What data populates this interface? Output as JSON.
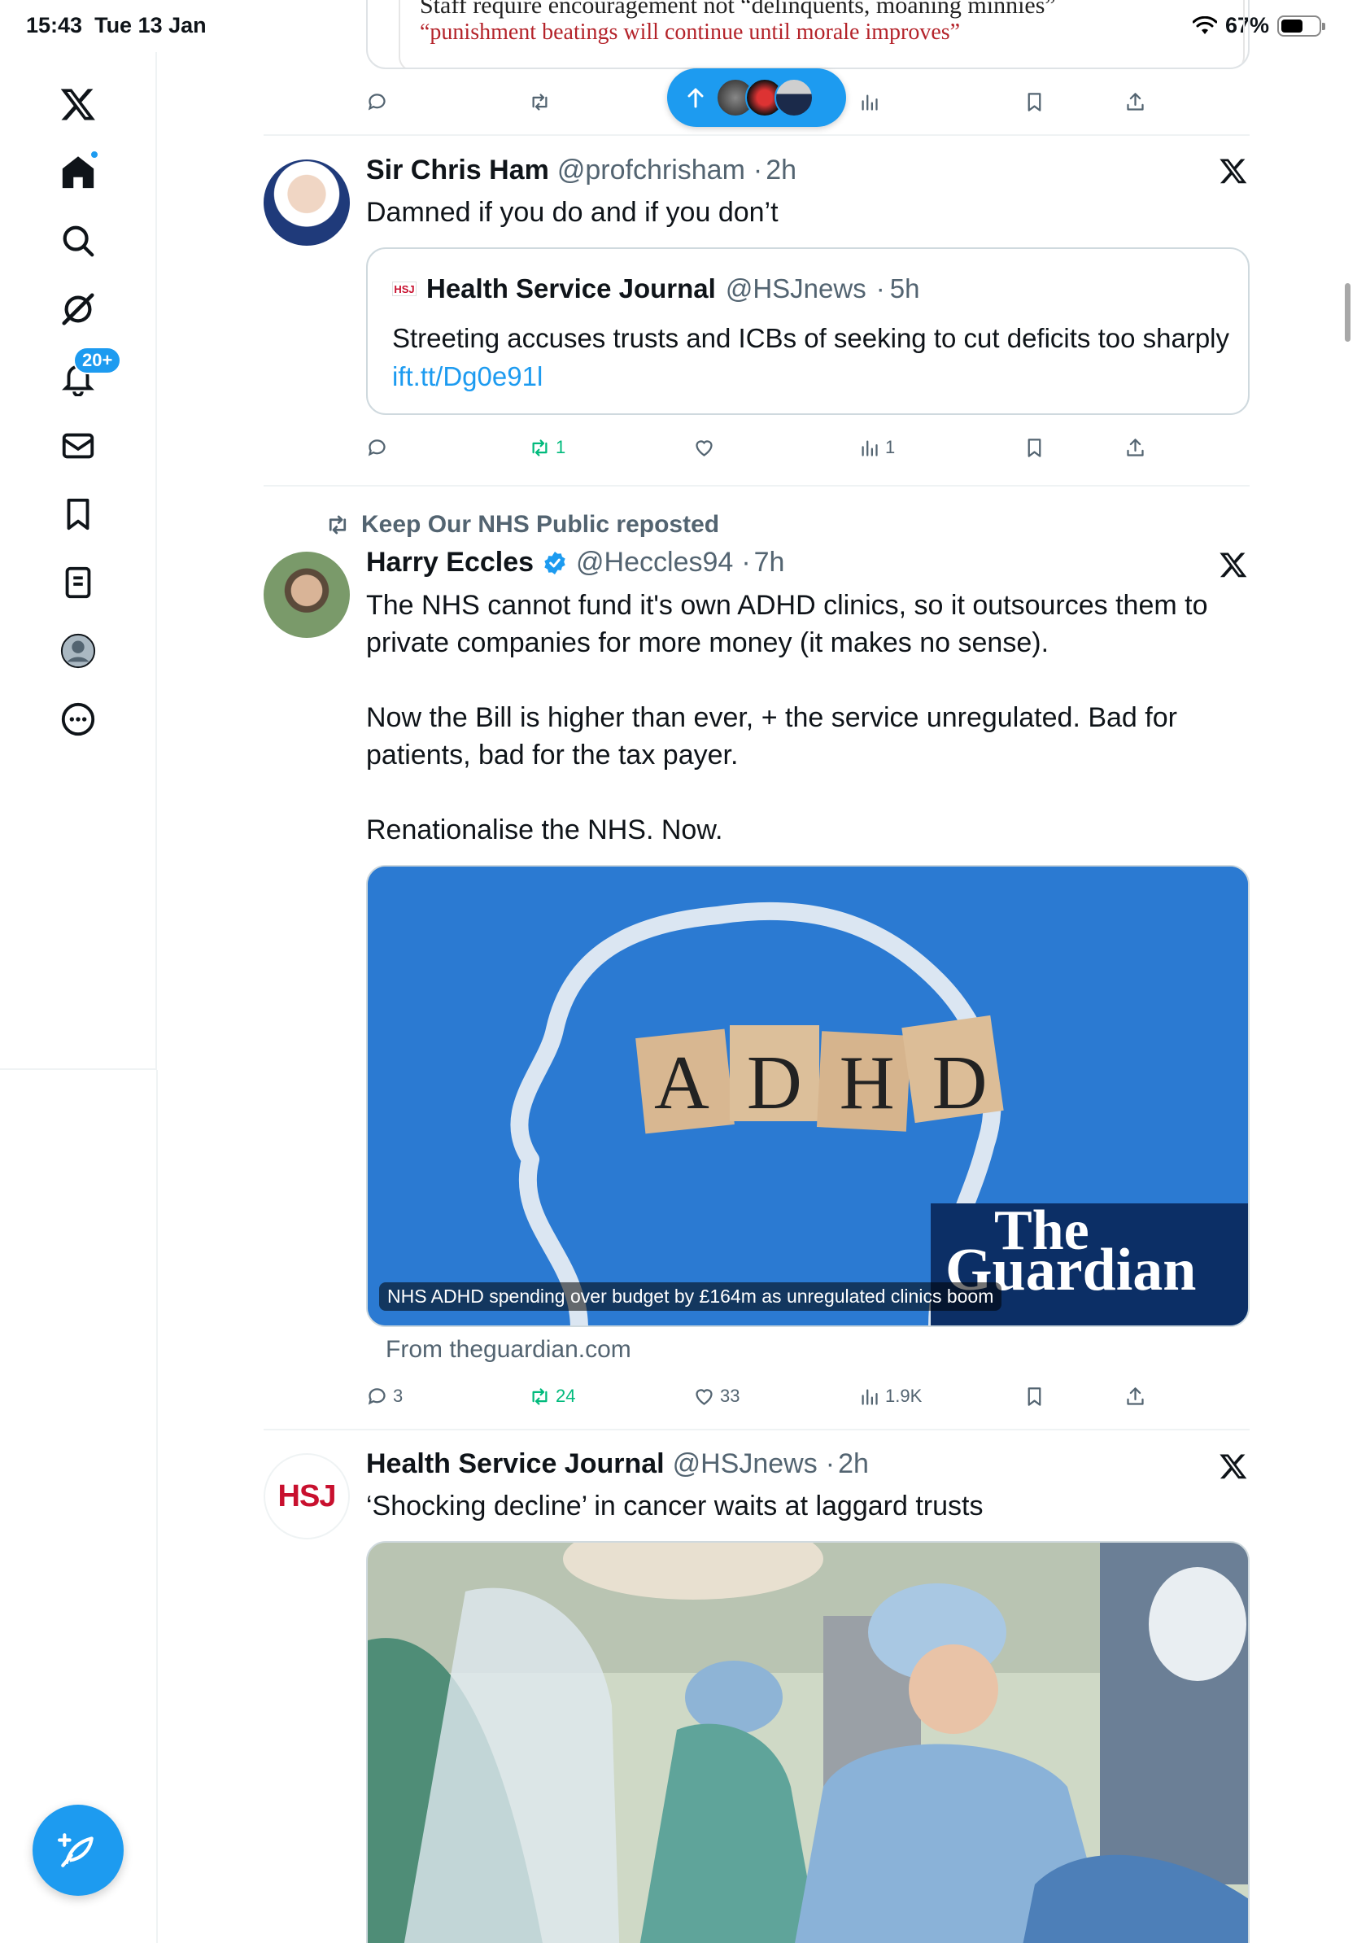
{
  "status_bar": {
    "time": "15:43",
    "date": "Tue 13 Jan",
    "battery": "67%"
  },
  "sidebar": {
    "items": [
      {
        "name": "home"
      },
      {
        "name": "search"
      },
      {
        "name": "grok"
      },
      {
        "name": "notifications",
        "badge": "20+"
      },
      {
        "name": "messages"
      },
      {
        "name": "bookmarks"
      },
      {
        "name": "lists"
      },
      {
        "name": "profile"
      },
      {
        "name": "more"
      }
    ]
  },
  "previous_post": {
    "quote_line1": "Staff require encouragement not “delinquents, moaning minnies”",
    "quote_line2": "“punishment beatings will continue until morale improves”"
  },
  "posts": [
    {
      "name": "Sir Chris Ham",
      "handle": "@profchrisham",
      "time": "2h",
      "text": "Damned if you do and if you don’t",
      "quote": {
        "logo": "HSJ",
        "name": "Health Service Journal",
        "handle": "@HSJnews",
        "time": "5h",
        "text": "Streeting accuses trusts and ICBs of seeking to cut deficits too sharply ",
        "link": "ift.tt/Dg0e91l"
      },
      "stats": {
        "replies": "",
        "reposts": "1",
        "likes": "",
        "views": "1"
      }
    },
    {
      "reposted_by": "Keep Our NHS Public reposted",
      "name": "Harry Eccles",
      "handle": "@Heccles94",
      "time": "7h",
      "text": "The NHS cannot fund it's own ADHD clinics, so it outsources them to private companies for more money (it makes no sense).\n\nNow the Bill is higher than ever, + the service unregulated. Bad for patients, bad for the tax payer.\n\nRenationalise the NHS. Now.",
      "card": {
        "image_text": "ADHD",
        "publisher_logo_line1": "The",
        "publisher_logo_line2": "Guardian",
        "caption": "NHS ADHD spending over budget by £164m as unregulated clinics boom",
        "source": "From theguardian.com"
      },
      "stats": {
        "replies": "3",
        "reposts": "24",
        "likes": "33",
        "views": "1.9K"
      }
    },
    {
      "name": "Health Service Journal",
      "handle": "@HSJnews",
      "time": "2h",
      "avatar_text": "HSJ",
      "text": "‘Shocking decline’ in cancer waits at laggard trusts"
    }
  ],
  "colors": {
    "accent": "#1d9bf0",
    "repost_green": "#00ba7c",
    "muted": "#536471"
  }
}
